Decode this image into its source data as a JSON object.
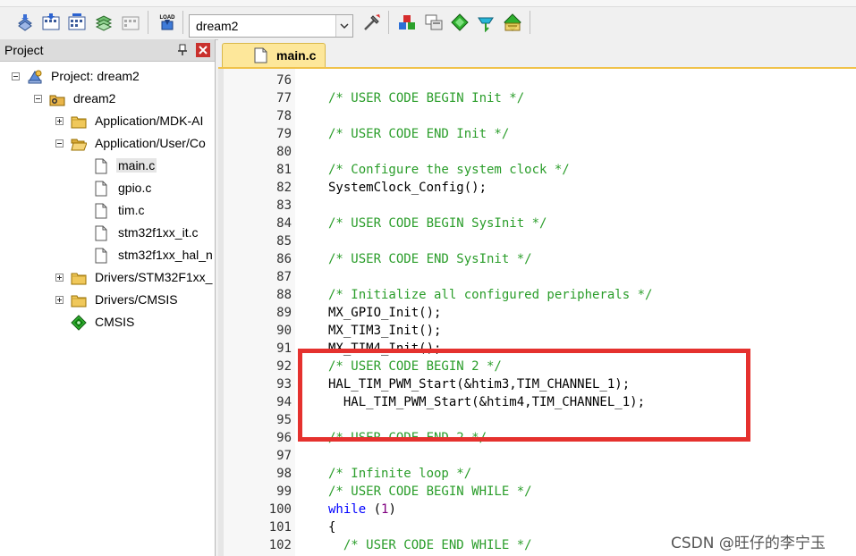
{
  "toolbar": {
    "target_value": "dream2",
    "buttons": [
      {
        "icon": "translate-icon"
      },
      {
        "icon": "build-icon"
      },
      {
        "icon": "rebuild-icon"
      },
      {
        "icon": "batch-build-icon"
      },
      {
        "icon": "stop-build-icon"
      },
      {
        "icon": "load-download-icon",
        "text": "LOAD"
      },
      {
        "icon": "target-options-icon"
      },
      {
        "icon": "manage-components-icon"
      },
      {
        "icon": "file-extensions-icon"
      },
      {
        "icon": "pack-installer-icon"
      },
      {
        "icon": "select-packs-icon"
      },
      {
        "icon": "run-time-env-icon"
      }
    ]
  },
  "project": {
    "title": "Project",
    "tree": [
      {
        "label": "Project: dream2",
        "icon": "project-icon",
        "level": 0,
        "expander": "minus"
      },
      {
        "label": "dream2",
        "icon": "target-icon",
        "level": 1,
        "expander": "minus"
      },
      {
        "label": "Application/MDK-AI",
        "icon": "folder-icon",
        "level": 2,
        "expander": "plus"
      },
      {
        "label": "Application/User/Co",
        "icon": "folder-open-icon",
        "level": 2,
        "expander": "minus"
      },
      {
        "label": "main.c",
        "icon": "file-icon",
        "level": 3,
        "selected": true
      },
      {
        "label": "gpio.c",
        "icon": "file-icon",
        "level": 3
      },
      {
        "label": "tim.c",
        "icon": "file-icon",
        "level": 3
      },
      {
        "label": "stm32f1xx_it.c",
        "icon": "file-icon",
        "level": 3
      },
      {
        "label": "stm32f1xx_hal_n",
        "icon": "file-icon",
        "level": 3
      },
      {
        "label": "Drivers/STM32F1xx_",
        "icon": "folder-icon",
        "level": 2,
        "expander": "plus"
      },
      {
        "label": "Drivers/CMSIS",
        "icon": "folder-icon",
        "level": 2,
        "expander": "plus"
      },
      {
        "label": "CMSIS",
        "icon": "cmsis-diamond-icon",
        "level": 2
      }
    ]
  },
  "editor": {
    "tab_label": "main.c",
    "lines": [
      {
        "n": "76",
        "text": ""
      },
      {
        "n": "77",
        "text": "/* USER CODE BEGIN Init */",
        "type": "comment"
      },
      {
        "n": "78",
        "text": ""
      },
      {
        "n": "79",
        "text": "/* USER CODE END Init */",
        "type": "comment"
      },
      {
        "n": "80",
        "text": ""
      },
      {
        "n": "81",
        "text": "/* Configure the system clock */",
        "type": "comment"
      },
      {
        "n": "82",
        "text": "SystemClock_Config();"
      },
      {
        "n": "83",
        "text": ""
      },
      {
        "n": "84",
        "text": "/* USER CODE BEGIN SysInit */",
        "type": "comment"
      },
      {
        "n": "85",
        "text": ""
      },
      {
        "n": "86",
        "text": "/* USER CODE END SysInit */",
        "type": "comment"
      },
      {
        "n": "87",
        "text": ""
      },
      {
        "n": "88",
        "text": "/* Initialize all configured peripherals */",
        "type": "comment"
      },
      {
        "n": "89",
        "text": "MX_GPIO_Init();"
      },
      {
        "n": "90",
        "text": "MX_TIM3_Init();"
      },
      {
        "n": "91",
        "text": "MX_TIM4_Init();"
      },
      {
        "n": "92",
        "text": "/* USER CODE BEGIN 2 */",
        "type": "comment"
      },
      {
        "n": "93",
        "text": "HAL_TIM_PWM_Start(&htim3,TIM_CHANNEL_1);"
      },
      {
        "n": "94",
        "text": "  HAL_TIM_PWM_Start(&htim4,TIM_CHANNEL_1);"
      },
      {
        "n": "95",
        "text": ""
      },
      {
        "n": "96",
        "text": "/* USER CODE END 2 */",
        "type": "comment"
      },
      {
        "n": "97",
        "text": ""
      },
      {
        "n": "98",
        "text": "/* Infinite loop */",
        "type": "comment"
      },
      {
        "n": "99",
        "text": "/* USER CODE BEGIN WHILE */",
        "type": "comment"
      },
      {
        "n": "100",
        "kw": "while",
        "num": "1"
      },
      {
        "n": "101",
        "text": "{",
        "fold": true
      },
      {
        "n": "102",
        "text": "  /* USER CODE END WHILE */",
        "type": "comment"
      }
    ]
  },
  "watermark": "CSDN @旺仔的李宁玉",
  "colors": {
    "comment": "#2a9d2a",
    "keyword": "#0000ff",
    "number": "#800080",
    "highlight_box": "#e5312e",
    "tab_active": "#fde79a"
  }
}
